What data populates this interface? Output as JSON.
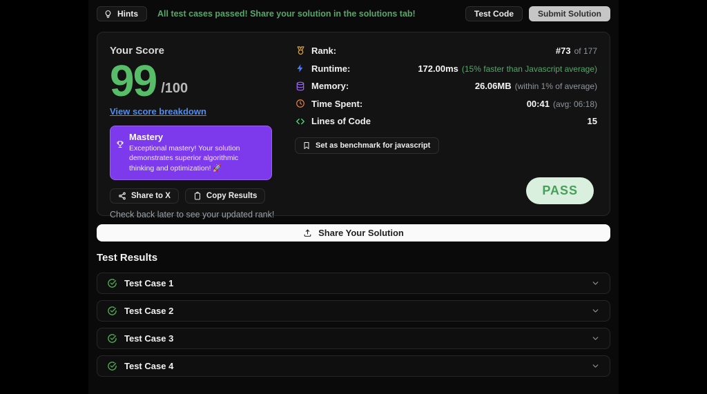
{
  "topbar": {
    "hints_label": "Hints",
    "message": "All test cases passed! Share your solution in the solutions tab!",
    "test_code_label": "Test Code",
    "submit_label": "Submit Solution"
  },
  "score": {
    "title": "Your Score",
    "value": "99",
    "denominator": "/100",
    "breakdown_link": "View score breakdown"
  },
  "mastery": {
    "title": "Mastery",
    "description": "Exceptional mastery! Your solution demonstrates superior algorithmic thinking and optimization! 🚀"
  },
  "stats": {
    "rank": {
      "label": "Rank:",
      "value": "#73",
      "note": "of 177"
    },
    "runtime": {
      "label": "Runtime:",
      "value": "172.00ms",
      "note": "(15% faster than Javascript average)"
    },
    "memory": {
      "label": "Memory:",
      "value": "26.06MB",
      "note": "(within 1% of average)"
    },
    "time_spent": {
      "label": "Time Spent:",
      "value": "00:41",
      "note": "(avg: 06:18)"
    },
    "lines_of_code": {
      "label": "Lines of Code",
      "value": "15",
      "note": ""
    }
  },
  "benchmark_button_label": "Set as benchmark for javascript",
  "share_buttons": {
    "share_to_x": "Share to X",
    "copy_results": "Copy Results"
  },
  "check_back_text": "Check back later to see your updated rank!",
  "pass_badge": "PASS",
  "share_solution_label": "Share Your Solution",
  "test_results": {
    "heading": "Test Results",
    "cases": [
      {
        "label": "Test Case 1",
        "status": "passed"
      },
      {
        "label": "Test Case 2",
        "status": "passed"
      },
      {
        "label": "Test Case 3",
        "status": "passed"
      },
      {
        "label": "Test Case 4",
        "status": "passed"
      }
    ]
  },
  "icons": {
    "hints": "lightbulb-icon",
    "rank": "medal-icon",
    "runtime": "lightning-icon",
    "memory": "database-icon",
    "time_spent": "clock-icon",
    "lines_of_code": "code-brackets-icon",
    "benchmark": "bookmark-icon",
    "share_to_x": "share-nodes-icon",
    "copy_results": "clipboard-icon",
    "share_solution": "upload-icon",
    "test_case": "check-circle-icon",
    "expand": "chevron-down-icon",
    "mastery": "trophy-icon"
  },
  "colors": {
    "accent_green": "#57bd68",
    "message_green": "#55a86a",
    "link_blue": "#4f8df2",
    "mastery_purple": "#7d3aed",
    "pass_bg": "#d8f0dd",
    "pass_text": "#47a05a",
    "rank_gold": "#d4a643",
    "runtime_blue": "#4b7bf5",
    "memory_purple": "#9d6bf0",
    "time_orange": "#e8834a",
    "code_green": "#4ade80"
  }
}
